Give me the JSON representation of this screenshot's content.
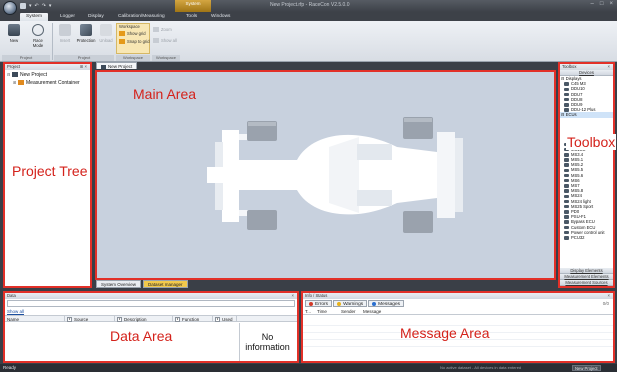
{
  "app": {
    "window_title": "New Project.rfp - RaceCon V2.5.0.0",
    "context_tab": "System",
    "quick_access": [
      "▾",
      "↶",
      "↷",
      "▾"
    ],
    "window_controls": [
      "–",
      "□",
      "×"
    ]
  },
  "ribbon": {
    "tabs": [
      "System",
      "Logger",
      "Display",
      "Calibration/Measuring",
      "Tools",
      "Windows"
    ],
    "active_tab": "System",
    "buttons": [
      {
        "label": "New",
        "enabled": true
      },
      {
        "label": "Race Mode",
        "enabled": true
      },
      {
        "label": "Insert",
        "enabled": false
      },
      {
        "label": "Protection",
        "enabled": true
      },
      {
        "label": "Unload",
        "enabled": false
      }
    ],
    "group_labels": [
      "Project",
      "Project",
      "Workspace",
      "Workspace"
    ],
    "workspace_title": "Workspace",
    "workspace_items": [
      "Show grid",
      "Snap to grid"
    ],
    "extra_items": [
      "Zoom",
      "Show all"
    ]
  },
  "project_tree": {
    "header": "Project",
    "items": [
      {
        "label": "New Project",
        "level": 0
      },
      {
        "label": "Measurement Container",
        "level": 1
      }
    ]
  },
  "main_area": {
    "doc_tab": "New Project",
    "bottom_tabs": [
      "System Overview",
      "Dataset manager"
    ]
  },
  "toolbox": {
    "header": "Toolbox",
    "top_category": "Devices",
    "items": [
      {
        "label": "Displays",
        "group": true
      },
      {
        "label": "C45 M3"
      },
      {
        "label": "DDU10"
      },
      {
        "label": "DDU7"
      },
      {
        "label": "DDU8"
      },
      {
        "label": "DDU9"
      },
      {
        "label": "DDU-12 Plus"
      },
      {
        "label": "ECUs",
        "group": true,
        "selected": true
      }
    ],
    "ecu_items": [
      "MS15.1",
      "MS15.2",
      "MS3.4",
      "MS5.1",
      "MS5.2",
      "MS5.5",
      "MS5.6",
      "MS6",
      "MS7",
      "MS5.8",
      "MS24",
      "MS24 light",
      "MS25 Sport",
      "PD0",
      "PSU-F1",
      "Bypass ECU",
      "Custom ECU",
      "Power control unit",
      "PCU32"
    ],
    "bottom_categories": [
      "Display Elements",
      "Measurement Elements",
      "Measurement Sources"
    ]
  },
  "data_area": {
    "header": "Data",
    "show_all": "Show all",
    "columns": [
      "Name",
      "Source",
      "Description",
      "Function",
      "Used"
    ],
    "empty_text": "No information"
  },
  "message_area": {
    "header": "Info / Status",
    "tabs": [
      {
        "label": "Errors",
        "color": "#d23a2a"
      },
      {
        "label": "Warnings",
        "color": "#e8b21a"
      },
      {
        "label": "Messages",
        "color": "#2b6fcf"
      }
    ],
    "columns": [
      "T...",
      "Time",
      "Sender",
      "Message"
    ],
    "counter": "0/0"
  },
  "status_bar": {
    "left": "Ready",
    "right_info": "No active dataset - All devices in data entered",
    "project": "New Project"
  },
  "annotations": {
    "main": "Main Area",
    "project_tree": "Project Tree",
    "toolbox": "Toolbox",
    "data": "Data Area",
    "message": "Message Area"
  }
}
